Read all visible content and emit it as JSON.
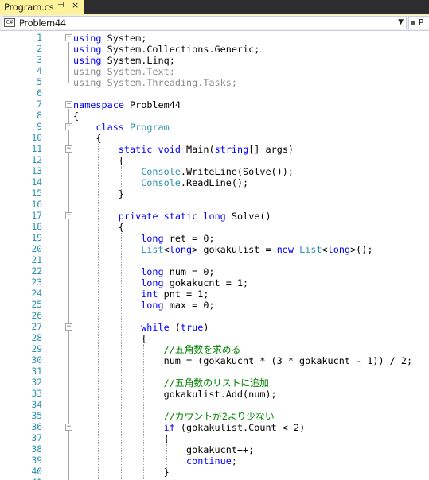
{
  "tab": {
    "title": "Program.cs",
    "pin": "⊣",
    "close": "×"
  },
  "navbar": {
    "class_selector": "Problem44",
    "class_icon": "C#",
    "member_selector": "P"
  },
  "colors": {
    "tab_active": "#fff29d",
    "tab_bg": "#2d2d30",
    "keyword": "#0000ff",
    "type": "#2b91af",
    "comment": "#008000",
    "line_number": "#2b91af"
  },
  "editor": {
    "lines": [
      {
        "n": "1",
        "fold": "minus",
        "indent": 0,
        "tokens": [
          [
            "kw",
            "using"
          ],
          [
            "pl",
            " System;"
          ]
        ]
      },
      {
        "n": "2",
        "fold": "",
        "indent": 0,
        "tokens": [
          [
            "kw",
            "using"
          ],
          [
            "pl",
            " System.Collections.Generic;"
          ]
        ]
      },
      {
        "n": "3",
        "fold": "",
        "indent": 0,
        "tokens": [
          [
            "kw",
            "using"
          ],
          [
            "pl",
            " System.Linq;"
          ]
        ]
      },
      {
        "n": "4",
        "fold": "",
        "indent": 0,
        "tokens": [
          [
            "dim",
            "using System.Text;"
          ]
        ]
      },
      {
        "n": "5",
        "fold": "",
        "indent": 0,
        "tokens": [
          [
            "dim",
            "using System.Threading.Tasks;"
          ]
        ]
      },
      {
        "n": "6",
        "fold": "",
        "indent": 0,
        "tokens": []
      },
      {
        "n": "7",
        "fold": "minus",
        "indent": 0,
        "tokens": [
          [
            "kw",
            "namespace"
          ],
          [
            "pl",
            " Problem44"
          ]
        ]
      },
      {
        "n": "8",
        "fold": "",
        "indent": 0,
        "tokens": [
          [
            "pl",
            "{"
          ]
        ]
      },
      {
        "n": "9",
        "fold": "minus",
        "indent": 4,
        "tokens": [
          [
            "kw",
            "class"
          ],
          [
            "pl",
            " "
          ],
          [
            "type",
            "Program"
          ]
        ]
      },
      {
        "n": "10",
        "fold": "",
        "indent": 4,
        "tokens": [
          [
            "pl",
            "{"
          ]
        ]
      },
      {
        "n": "11",
        "fold": "minus",
        "indent": 8,
        "tokens": [
          [
            "kw",
            "static"
          ],
          [
            "pl",
            " "
          ],
          [
            "kw",
            "void"
          ],
          [
            "pl",
            " Main("
          ],
          [
            "kw",
            "string"
          ],
          [
            "pl",
            "[] args)"
          ]
        ]
      },
      {
        "n": "12",
        "fold": "",
        "indent": 8,
        "tokens": [
          [
            "pl",
            "{"
          ]
        ]
      },
      {
        "n": "13",
        "fold": "",
        "indent": 12,
        "tokens": [
          [
            "type",
            "Console"
          ],
          [
            "pl",
            ".WriteLine(Solve());"
          ]
        ]
      },
      {
        "n": "14",
        "fold": "",
        "indent": 12,
        "tokens": [
          [
            "type",
            "Console"
          ],
          [
            "pl",
            ".ReadLine();"
          ]
        ]
      },
      {
        "n": "15",
        "fold": "",
        "indent": 8,
        "tokens": [
          [
            "pl",
            "}"
          ]
        ]
      },
      {
        "n": "16",
        "fold": "",
        "indent": 0,
        "tokens": []
      },
      {
        "n": "17",
        "fold": "minus",
        "indent": 8,
        "tokens": [
          [
            "kw",
            "private"
          ],
          [
            "pl",
            " "
          ],
          [
            "kw",
            "static"
          ],
          [
            "pl",
            " "
          ],
          [
            "kw",
            "long"
          ],
          [
            "pl",
            " Solve()"
          ]
        ]
      },
      {
        "n": "18",
        "fold": "",
        "indent": 8,
        "tokens": [
          [
            "pl",
            "{"
          ]
        ]
      },
      {
        "n": "19",
        "fold": "",
        "indent": 12,
        "tokens": [
          [
            "kw",
            "long"
          ],
          [
            "pl",
            " ret = 0;"
          ]
        ]
      },
      {
        "n": "20",
        "fold": "",
        "indent": 12,
        "tokens": [
          [
            "type",
            "List"
          ],
          [
            "pl",
            "<"
          ],
          [
            "kw",
            "long"
          ],
          [
            "pl",
            "> gokakulist = "
          ],
          [
            "kw",
            "new"
          ],
          [
            "pl",
            " "
          ],
          [
            "type",
            "List"
          ],
          [
            "pl",
            "<"
          ],
          [
            "kw",
            "long"
          ],
          [
            "pl",
            ">();"
          ]
        ]
      },
      {
        "n": "21",
        "fold": "",
        "indent": 0,
        "tokens": []
      },
      {
        "n": "22",
        "fold": "",
        "indent": 12,
        "tokens": [
          [
            "kw",
            "long"
          ],
          [
            "pl",
            " num = 0;"
          ]
        ]
      },
      {
        "n": "23",
        "fold": "",
        "indent": 12,
        "tokens": [
          [
            "kw",
            "long"
          ],
          [
            "pl",
            " gokakucnt = 1;"
          ]
        ]
      },
      {
        "n": "24",
        "fold": "",
        "indent": 12,
        "tokens": [
          [
            "kw",
            "int"
          ],
          [
            "pl",
            " pnt = 1;"
          ]
        ]
      },
      {
        "n": "25",
        "fold": "",
        "indent": 12,
        "tokens": [
          [
            "kw",
            "long"
          ],
          [
            "pl",
            " max = 0;"
          ]
        ]
      },
      {
        "n": "26",
        "fold": "",
        "indent": 0,
        "tokens": []
      },
      {
        "n": "27",
        "fold": "minus",
        "indent": 12,
        "tokens": [
          [
            "kw",
            "while"
          ],
          [
            "pl",
            " ("
          ],
          [
            "kw",
            "true"
          ],
          [
            "pl",
            ")"
          ]
        ]
      },
      {
        "n": "28",
        "fold": "",
        "indent": 12,
        "tokens": [
          [
            "pl",
            "{"
          ]
        ]
      },
      {
        "n": "29",
        "fold": "",
        "indent": 16,
        "tokens": [
          [
            "com",
            "//五角数を求める"
          ]
        ]
      },
      {
        "n": "30",
        "fold": "",
        "indent": 16,
        "tokens": [
          [
            "pl",
            "num = (gokakucnt * (3 * gokakucnt - 1)) / 2;"
          ]
        ]
      },
      {
        "n": "31",
        "fold": "",
        "indent": 0,
        "tokens": []
      },
      {
        "n": "32",
        "fold": "",
        "indent": 16,
        "tokens": [
          [
            "com",
            "//五角数のリストに追加"
          ]
        ]
      },
      {
        "n": "33",
        "fold": "",
        "indent": 16,
        "tokens": [
          [
            "pl",
            "gokakulist.Add(num);"
          ]
        ]
      },
      {
        "n": "34",
        "fold": "",
        "indent": 0,
        "tokens": []
      },
      {
        "n": "35",
        "fold": "",
        "indent": 16,
        "tokens": [
          [
            "com",
            "//カウントが2より少ない"
          ]
        ]
      },
      {
        "n": "36",
        "fold": "minus",
        "indent": 16,
        "tokens": [
          [
            "kw",
            "if"
          ],
          [
            "pl",
            " (gokakulist.Count < 2)"
          ]
        ]
      },
      {
        "n": "37",
        "fold": "",
        "indent": 16,
        "tokens": [
          [
            "pl",
            "{"
          ]
        ]
      },
      {
        "n": "38",
        "fold": "",
        "indent": 20,
        "tokens": [
          [
            "pl",
            "gokakucnt++;"
          ]
        ]
      },
      {
        "n": "39",
        "fold": "",
        "indent": 20,
        "tokens": [
          [
            "kw",
            "continue"
          ],
          [
            "pl",
            ";"
          ]
        ]
      },
      {
        "n": "40",
        "fold": "",
        "indent": 16,
        "tokens": [
          [
            "pl",
            "}"
          ]
        ]
      },
      {
        "n": "41",
        "fold": "",
        "indent": 0,
        "tokens": []
      }
    ]
  }
}
